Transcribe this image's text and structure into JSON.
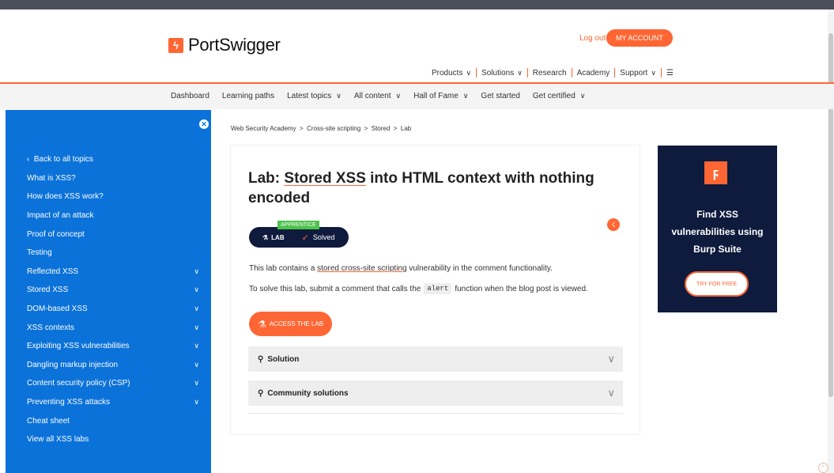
{
  "header": {
    "logo_mark": "ϟ",
    "logo_text": "PortSwigger",
    "login_label": "Log out",
    "account_label": "MY ACCOUNT",
    "nav": [
      {
        "label": "Products",
        "dropdown": true
      },
      {
        "label": "Solutions",
        "dropdown": true
      },
      {
        "label": "Research",
        "dropdown": false
      },
      {
        "label": "Academy",
        "dropdown": false
      },
      {
        "label": "Support",
        "dropdown": true
      }
    ],
    "menu_icon": "hamburger-icon"
  },
  "subnav": {
    "dashboard": "Dashboard",
    "learning_paths": "Learning paths",
    "latest_topics": "Latest topics",
    "all_content": "All content",
    "hall_of_fame": "Hall of Fame",
    "get_started": "Get started",
    "get_certified": "Get certified"
  },
  "sidebar": {
    "items": [
      {
        "label": "Back to all topics",
        "expandable": false
      },
      {
        "label": "What is XSS?",
        "expandable": false
      },
      {
        "label": "How does XSS work?",
        "expandable": false
      },
      {
        "label": "Impact of an attack",
        "expandable": false
      },
      {
        "label": "Proof of concept",
        "expandable": false
      },
      {
        "label": "Testing",
        "expandable": false
      },
      {
        "label": "Reflected XSS",
        "expandable": true
      },
      {
        "label": "Stored XSS",
        "expandable": true
      },
      {
        "label": "DOM-based XSS",
        "expandable": true
      },
      {
        "label": "XSS contexts",
        "expandable": true
      },
      {
        "label": "Exploiting XSS vulnerabilities",
        "expandable": true
      },
      {
        "label": "Dangling markup injection",
        "expandable": true
      },
      {
        "label": "Content security policy (CSP)",
        "expandable": true
      },
      {
        "label": "Preventing XSS attacks",
        "expandable": true
      },
      {
        "label": "Cheat sheet",
        "expandable": false
      },
      {
        "label": "View all XSS labs",
        "expandable": false
      }
    ]
  },
  "breadcrumb": {
    "items": [
      "Web Security Academy",
      "Cross-site scripting",
      "Stored",
      "Lab"
    ],
    "sep": ">"
  },
  "lab": {
    "title_prefix": "Lab: ",
    "title_link": "Stored XSS",
    "title_rest": " into HTML context with nothing encoded",
    "level": "APPRENTICE",
    "lab_label": "LAB",
    "status": "Solved",
    "desc1_pre": "This lab contains a ",
    "desc1_link": "stored cross-site scripting",
    "desc1_post": " vulnerability in the comment functionality.",
    "desc2_pre": "To solve this lab, submit a comment that calls the",
    "desc2_code": "alert",
    "desc2_post": "function when the blog post is viewed.",
    "access_label": "ACCESS THE LAB",
    "solution_label": "Solution",
    "community_label": "Community solutions"
  },
  "ad": {
    "line1": "Find XSS",
    "line2": "vulnerabilities using",
    "line3": "Burp Suite",
    "button": "TRY FOR FREE"
  },
  "colors": {
    "brand": "#ff6633",
    "sidebar": "#0b72d9",
    "dark": "#0e1b3d",
    "level": "#4bc24b"
  }
}
